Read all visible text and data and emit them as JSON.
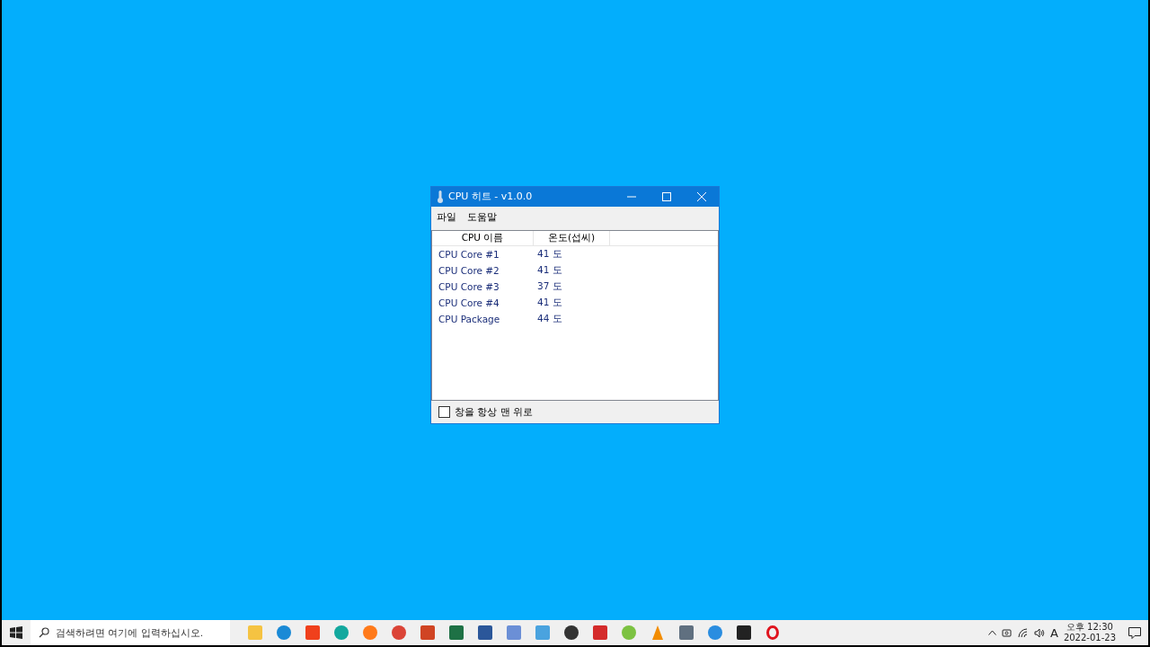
{
  "window": {
    "title": "CPU 히트 - v1.0.0"
  },
  "menu": [
    "파일",
    "도움말"
  ],
  "table": {
    "columns": [
      "CPU 이름",
      "온도(섭씨)"
    ],
    "rows": [
      {
        "name": "CPU Core #1",
        "temp": "41 도"
      },
      {
        "name": "CPU Core #2",
        "temp": "41 도"
      },
      {
        "name": "CPU Core #3",
        "temp": "37 도"
      },
      {
        "name": "CPU Core #4",
        "temp": "41 도"
      },
      {
        "name": "CPU Package",
        "temp": "44 도"
      }
    ]
  },
  "always_on_top": {
    "label": "창을 항상 맨 위로",
    "checked": false
  },
  "taskbar": {
    "search_placeholder": "검색하려면 여기에 입력하십시오.",
    "input_indicator": "A",
    "time": "오후 12:30",
    "date": "2022-01-23"
  }
}
